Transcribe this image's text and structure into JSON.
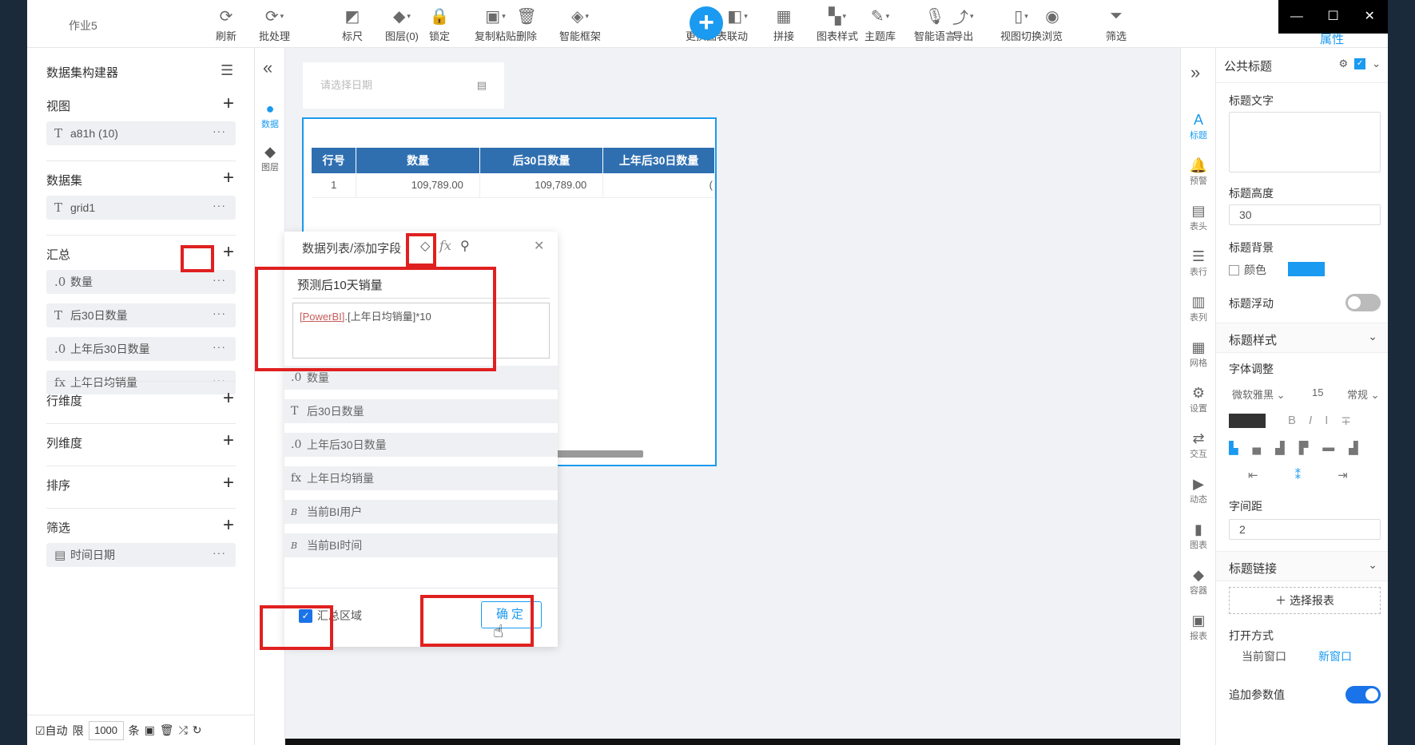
{
  "window": {
    "doc_title": "作业5",
    "controls": [
      "—",
      "☐",
      "✕"
    ],
    "attr_tab": "属性"
  },
  "toolbar": [
    {
      "name": "refresh",
      "label": "刷新",
      "icon": "⟳",
      "dd": false
    },
    {
      "name": "batch",
      "label": "批处理",
      "icon": "⟳",
      "dd": true
    },
    {
      "name": "ruler",
      "label": "标尺",
      "icon": "◩",
      "dd": false
    },
    {
      "name": "layer",
      "label": "图层(0)",
      "icon": "◆",
      "dd": true
    },
    {
      "name": "lock",
      "label": "锁定",
      "icon": "🔒",
      "dd": false
    },
    {
      "name": "copy-paste",
      "label": "复制粘贴",
      "icon": "▣",
      "dd": true
    },
    {
      "name": "delete",
      "label": "删除",
      "icon": "🗑",
      "dd": false
    },
    {
      "name": "smart-frame",
      "label": "智能框架",
      "icon": "◈",
      "dd": true
    },
    {
      "name": "change-chart",
      "label": "更换图表",
      "icon": "◈",
      "dd": true
    },
    {
      "name": "link",
      "label": "联动",
      "icon": "◧",
      "dd": true
    },
    {
      "name": "splice",
      "label": "拼接",
      "icon": "▦",
      "dd": false
    },
    {
      "name": "chart-style",
      "label": "图表样式",
      "icon": "▚",
      "dd": true
    },
    {
      "name": "theme",
      "label": "主题库",
      "icon": "✎",
      "dd": true
    },
    {
      "name": "voice",
      "label": "智能语言",
      "icon": "🎙",
      "dd": false
    },
    {
      "name": "export",
      "label": "导出",
      "icon": "⤴",
      "dd": true
    },
    {
      "name": "view-switch",
      "label": "视图切换",
      "icon": "▯",
      "dd": true
    },
    {
      "name": "browse",
      "label": "浏览",
      "icon": "◉",
      "dd": false
    },
    {
      "name": "filter",
      "label": "筛选",
      "icon": "⏷",
      "dd": false
    }
  ],
  "left_panel": {
    "title": "数据集构建器",
    "sections": [
      {
        "title": "视图",
        "items": [
          {
            "type": "T",
            "label": "a81h (10)"
          }
        ]
      },
      {
        "title": "数据集",
        "items": [
          {
            "type": "T",
            "label": "grid1"
          }
        ]
      },
      {
        "title": "汇总",
        "items": [
          {
            "type": ".0",
            "label": "数量"
          },
          {
            "type": "T",
            "label": "后30日数量"
          },
          {
            "type": ".0",
            "label": "上年后30日数量"
          },
          {
            "type": "fx",
            "label": "上年日均销量"
          }
        ]
      },
      {
        "title": "行维度",
        "items": []
      },
      {
        "title": "列维度",
        "items": []
      },
      {
        "title": "排序",
        "items": []
      },
      {
        "title": "筛选",
        "items": [
          {
            "type": "▤",
            "label": "时间日期"
          }
        ]
      }
    ],
    "bottom": {
      "auto": "☑自动",
      "limit_label": "限",
      "limit": "1000",
      "unit": "条"
    }
  },
  "nav": [
    {
      "label": "数据",
      "icon": "●",
      "active": true
    },
    {
      "label": "图层",
      "icon": "◆",
      "active": false
    }
  ],
  "canvas": {
    "date_placeholder": "请选择日期",
    "table": {
      "headers": [
        "行号",
        "数量",
        "后30日数量",
        "上年后30日数量"
      ],
      "rows": [
        [
          "1",
          "109,789.00",
          "109,789.00",
          "("
        ]
      ]
    }
  },
  "popup": {
    "title": "数据列表/添加字段",
    "field_name": "预测后10天销量",
    "expr_link": "[PowerBI]",
    "expr_rest": ".[上年日均销量]*10",
    "items": [
      {
        "type": ".0",
        "label": "数量"
      },
      {
        "type": "T",
        "label": "后30日数量"
      },
      {
        "type": ".0",
        "label": "上年后30日数量"
      },
      {
        "type": "fx",
        "label": "上年日均销量"
      },
      {
        "type": "B",
        "label": "当前BI用户"
      },
      {
        "type": "B",
        "label": "当前BI时间"
      }
    ],
    "checkbox_label": "汇总区域",
    "ok_label": "确定"
  },
  "right_icons": [
    {
      "label": "标题",
      "icon": "A",
      "active": true
    },
    {
      "label": "预警",
      "icon": "🔔",
      "active": false
    },
    {
      "label": "表头",
      "icon": "▤",
      "active": false
    },
    {
      "label": "表行",
      "icon": "☰",
      "active": false
    },
    {
      "label": "表列",
      "icon": "▥",
      "active": false
    },
    {
      "label": "网格",
      "icon": "▦",
      "active": false
    },
    {
      "label": "设置",
      "icon": "⚙",
      "active": false
    },
    {
      "label": "交互",
      "icon": "⇄",
      "active": false
    },
    {
      "label": "动态",
      "icon": "▶",
      "active": false
    },
    {
      "label": "图表",
      "icon": "▮",
      "active": false
    },
    {
      "label": "容器",
      "icon": "◆",
      "active": false
    },
    {
      "label": "报表",
      "icon": "▣",
      "active": false
    }
  ],
  "props": {
    "header": "公共标题",
    "title_text_label": "标题文字",
    "title_height_label": "标题高度",
    "title_height": "30",
    "title_bg_label": "标题背景",
    "color_label": "颜色",
    "title_float_label": "标题浮动",
    "title_style_label": "标题样式",
    "font_adjust_label": "字体调整",
    "font_name": "微软雅黑",
    "font_size": "15",
    "font_weight": "常规",
    "letter_spacing_label": "字间距",
    "letter_spacing": "2",
    "title_link_label": "标题链接",
    "select_report": "选择报表",
    "open_mode_label": "打开方式",
    "current_window": "当前窗口",
    "new_window": "新窗口",
    "append_param_label": "追加参数值",
    "accent": "#1a9af0"
  }
}
